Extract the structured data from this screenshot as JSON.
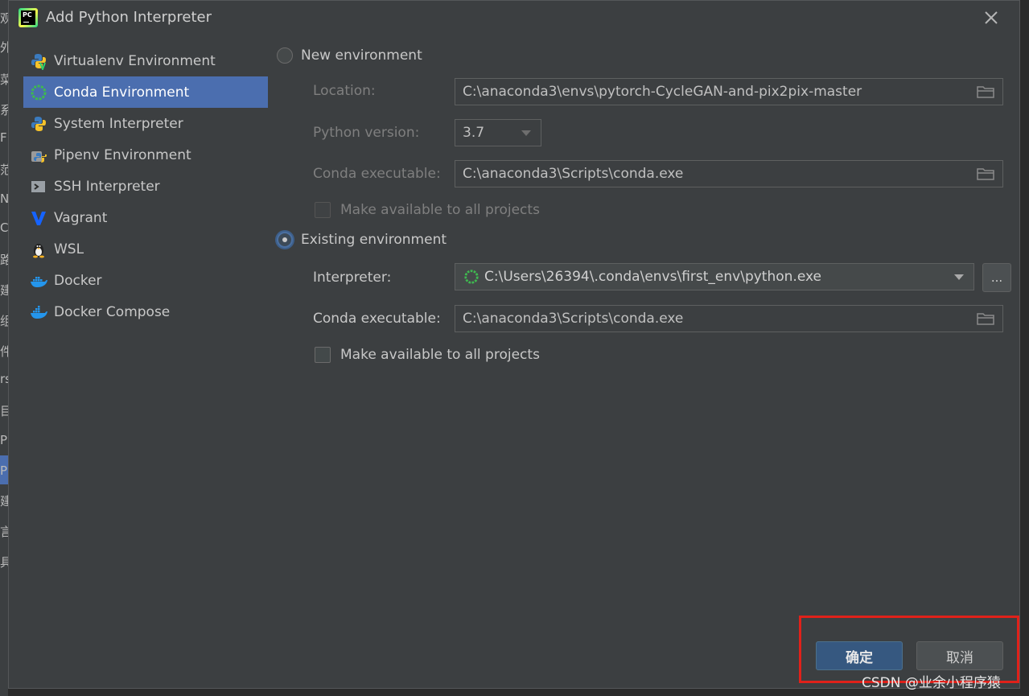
{
  "dialog": {
    "title": "Add Python Interpreter"
  },
  "sidebar": {
    "items": [
      {
        "label": "Virtualenv Environment",
        "icon": "python-virtualenv-icon",
        "selected": false
      },
      {
        "label": "Conda Environment",
        "icon": "conda-icon",
        "selected": true
      },
      {
        "label": "System Interpreter",
        "icon": "python-icon",
        "selected": false
      },
      {
        "label": "Pipenv Environment",
        "icon": "pipenv-icon",
        "selected": false
      },
      {
        "label": "SSH Interpreter",
        "icon": "ssh-terminal-icon",
        "selected": false
      },
      {
        "label": "Vagrant",
        "icon": "vagrant-icon",
        "selected": false
      },
      {
        "label": "WSL",
        "icon": "linux-penguin-icon",
        "selected": false
      },
      {
        "label": "Docker",
        "icon": "docker-icon",
        "selected": false
      },
      {
        "label": "Docker Compose",
        "icon": "docker-compose-icon",
        "selected": false
      }
    ]
  },
  "new_env": {
    "radio_label": "New environment",
    "location_label": "Location:",
    "location_value": "C:\\anaconda3\\envs\\pytorch-CycleGAN-and-pix2pix-master",
    "python_version_label": "Python version:",
    "python_version_value": "3.7",
    "conda_exec_label": "Conda executable:",
    "conda_exec_value": "C:\\anaconda3\\Scripts\\conda.exe",
    "make_available_label": "Make available to all projects"
  },
  "existing_env": {
    "radio_label": "Existing environment",
    "interpreter_label": "Interpreter:",
    "interpreter_value": "C:\\Users\\26394\\.conda\\envs\\first_env\\python.exe",
    "browse_label": "...",
    "conda_exec_label": "Conda executable:",
    "conda_exec_value": "C:\\anaconda3\\Scripts\\conda.exe",
    "make_available_label": "Make available to all projects"
  },
  "buttons": {
    "ok_label": "确定",
    "cancel_label": "取消"
  },
  "background_glyphs": [
    "观",
    "外",
    "菜",
    "系",
    "F",
    "范",
    "N",
    "C",
    "路",
    "建",
    "组",
    "件",
    "rs",
    "目",
    "P",
    "P",
    "建",
    "言",
    "具"
  ],
  "watermark": "CSDN @业余小程序猿",
  "colors": {
    "dialog_bg": "#3c3f41",
    "selection": "#4b6eaf",
    "primary_button": "#365880",
    "highlight_box": "#e0211a"
  }
}
